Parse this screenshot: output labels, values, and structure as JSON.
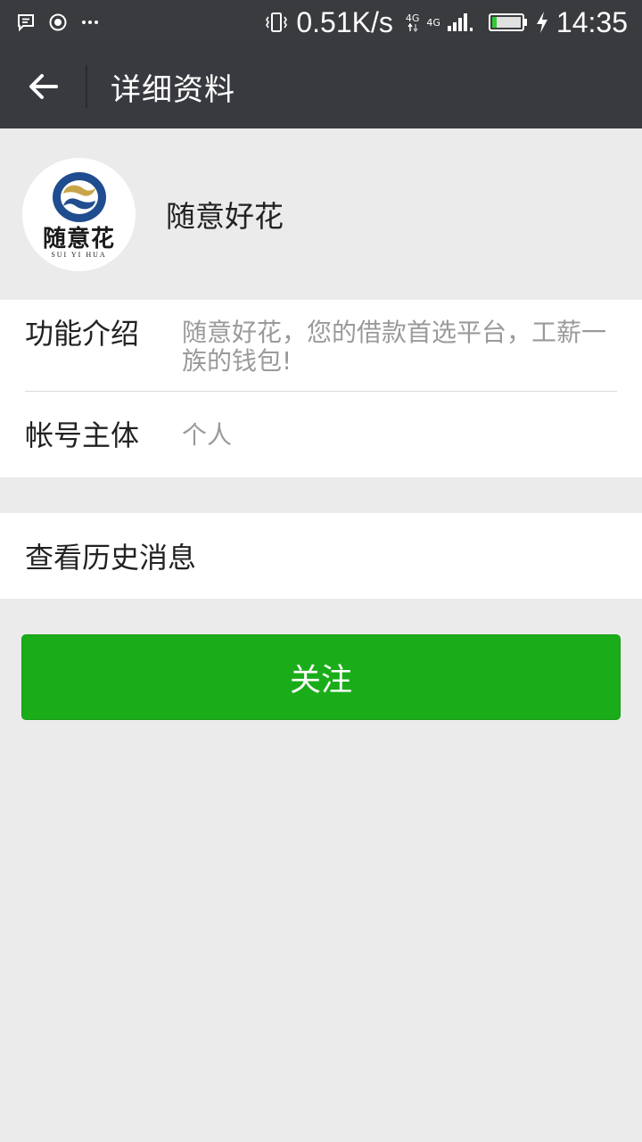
{
  "status_bar": {
    "network_speed": "0.51K/s",
    "network_type_1": "4G",
    "network_type_2": "4G",
    "time": "14:35",
    "icons": [
      "message-icon",
      "record-icon",
      "more-icon",
      "vibrate-icon",
      "signal-icon",
      "battery-icon",
      "charging-icon"
    ]
  },
  "app_bar": {
    "title": "详细资料",
    "back_icon": "back-arrow-icon"
  },
  "profile": {
    "name": "随意好花",
    "avatar_text": "随意花",
    "avatar_subtext": "SUI YI HUA",
    "avatar_colors": {
      "blue": "#1f4d8f",
      "gold": "#c9a54a"
    }
  },
  "info": {
    "intro_label": "功能介绍",
    "intro_value": "随意好花，您的借款首选平台，工薪一族的钱包!",
    "account_label": "帐号主体",
    "account_value": "个人"
  },
  "history": {
    "label": "查看历史消息"
  },
  "follow": {
    "label": "关注",
    "color": "#1aad19"
  }
}
